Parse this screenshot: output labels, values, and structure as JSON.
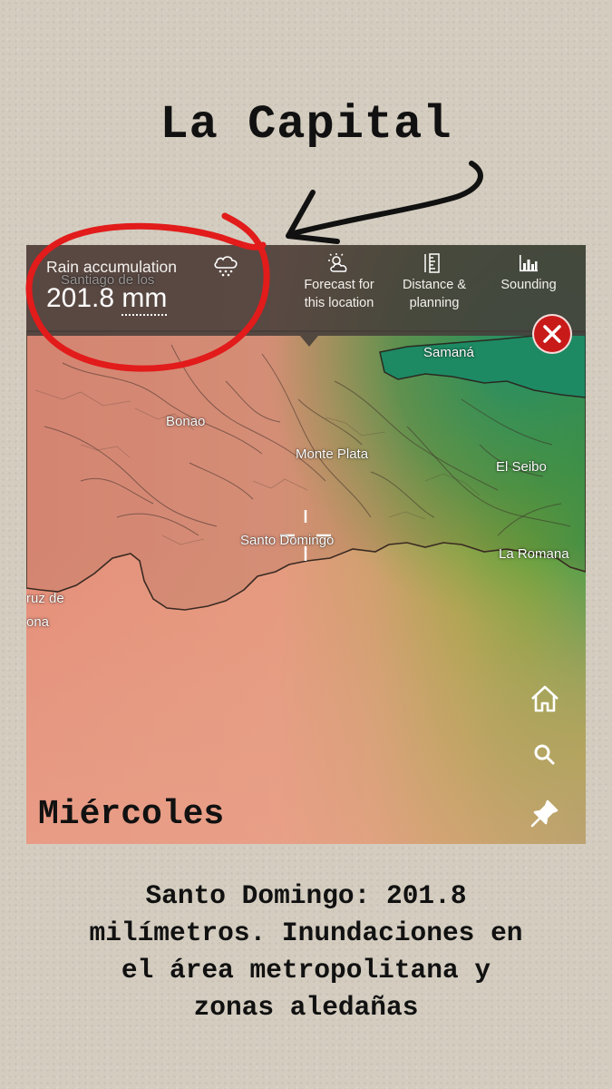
{
  "headline": "La Capital",
  "map": {
    "rain_label": "Rain accumulation",
    "rain_value": "201.8",
    "rain_unit": "mm",
    "tools": [
      {
        "icon": "forecast-cloud-sun-icon",
        "line1": "Forecast for",
        "line2": "this location"
      },
      {
        "icon": "distance-ruler-icon",
        "line1": "Distance &",
        "line2": "planning"
      },
      {
        "icon": "sounding-chart-icon",
        "line1": "Sounding",
        "line2": ""
      }
    ],
    "places": {
      "samana": "Samaná",
      "bonao": "Bonao",
      "monte_plata": "Monte Plata",
      "el_seibo": "El Seibo",
      "santo_domingo": "Santo Domingo",
      "la_romana": "La Romana",
      "santiago_partial": "Santiago de los",
      "cruz_de_partial": "ruz de",
      "ona_partial": "ona"
    },
    "day_label": "Miércoles",
    "side_icons": [
      "home-icon",
      "search-icon",
      "pin-icon"
    ]
  },
  "caption": {
    "line1": "Santo Domingo: 201.8",
    "line2": "milímetros. Inundaciones en",
    "line3": "el área metropolitana y",
    "line4": "zonas aledañas"
  },
  "colors": {
    "annotation_red": "#e21b1b",
    "close_button": "#c91a1a",
    "top_bar": "#463e3a"
  }
}
